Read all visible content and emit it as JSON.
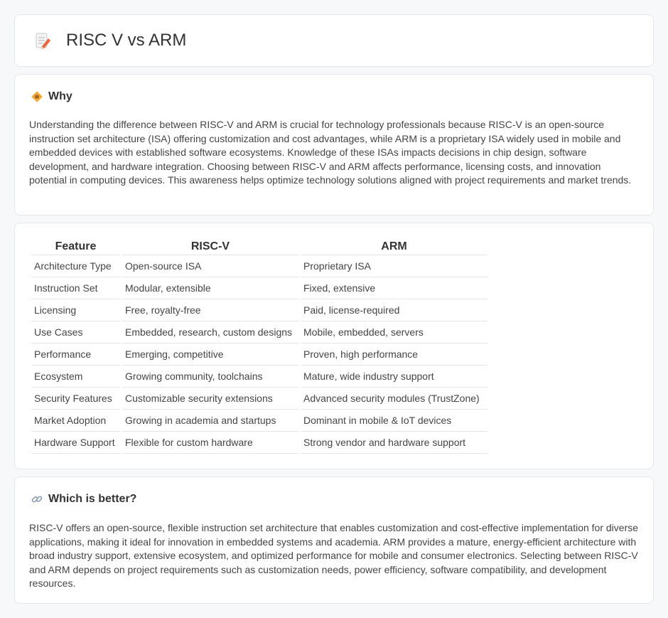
{
  "header": {
    "title": "RISC V vs ARM",
    "icon": "document-pencil-icon"
  },
  "why": {
    "heading": "Why",
    "icon": "diamond-signal-icon",
    "text": "Understanding the difference between RISC-V and ARM is crucial for technology professionals because RISC-V is an open-source instruction set architecture (ISA) offering customization and cost advantages, while ARM is a proprietary ISA widely used in mobile and embedded devices with established software ecosystems. Knowledge of these ISAs impacts decisions in chip design, software development, and hardware integration. Choosing between RISC-V and ARM affects performance, licensing costs, and innovation potential in computing devices. This awareness helps optimize technology solutions aligned with project requirements and market trends."
  },
  "table": {
    "headers": [
      "Feature",
      "RISC-V",
      "ARM"
    ],
    "rows": [
      [
        "Architecture Type",
        "Open-source ISA",
        "Proprietary ISA"
      ],
      [
        "Instruction Set",
        "Modular, extensible",
        "Fixed, extensive"
      ],
      [
        "Licensing",
        "Free, royalty-free",
        "Paid, license-required"
      ],
      [
        "Use Cases",
        "Embedded, research, custom designs",
        "Mobile, embedded, servers"
      ],
      [
        "Performance",
        "Emerging, competitive",
        "Proven, high performance"
      ],
      [
        "Ecosystem",
        "Growing community, toolchains",
        "Mature, wide industry support"
      ],
      [
        "Security Features",
        "Customizable security extensions",
        "Advanced security modules (TrustZone)"
      ],
      [
        "Market Adoption",
        "Growing in academia and startups",
        "Dominant in mobile & IoT devices"
      ],
      [
        "Hardware Support",
        "Flexible for custom hardware",
        "Strong vendor and hardware support"
      ]
    ]
  },
  "better": {
    "heading": "Which is better?",
    "icon": "link-icon",
    "text": "RISC-V offers an open-source, flexible instruction set architecture that enables customization and cost-effective implementation for diverse applications, making it ideal for innovation in embedded systems and academia. ARM provides a mature, energy-efficient architecture with broad industry support, extensive ecosystem, and optimized performance for mobile and consumer electronics. Selecting between RISC-V and ARM depends on project requirements such as customization needs, power efficiency, software compatibility, and development resources."
  }
}
